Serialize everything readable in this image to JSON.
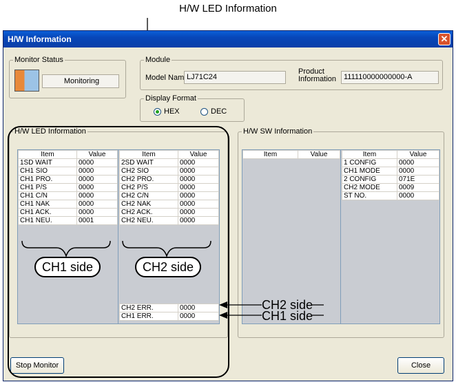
{
  "caption": "H/W LED Information",
  "window": {
    "title": "H/W Information",
    "close": "✕"
  },
  "monitor_status": {
    "label": "Monitor Status",
    "value": "Monitoring"
  },
  "module": {
    "label": "Module",
    "model_name_label": "Model Name",
    "model_name": "LJ71C24",
    "product_info_label": "Product Information",
    "product_info": "111110000000000-A"
  },
  "display_format": {
    "label": "Display Format",
    "hex": "HEX",
    "dec": "DEC",
    "selected": "HEX"
  },
  "led": {
    "label": "H/W LED Information",
    "headers": [
      "Item",
      "Value"
    ],
    "left": [
      [
        "1SD WAIT",
        "0000"
      ],
      [
        "CH1 SIO",
        "0000"
      ],
      [
        "CH1 PRO.",
        "0000"
      ],
      [
        "CH1 P/S",
        "0000"
      ],
      [
        "CH1 C/N",
        "0000"
      ],
      [
        "CH1 NAK",
        "0000"
      ],
      [
        "CH1 ACK.",
        "0000"
      ],
      [
        "CH1 NEU.",
        "0001"
      ]
    ],
    "right": [
      [
        "2SD WAIT",
        "0000"
      ],
      [
        "CH2 SIO",
        "0000"
      ],
      [
        "CH2 PRO.",
        "0000"
      ],
      [
        "CH2 P/S",
        "0000"
      ],
      [
        "CH2 C/N",
        "0000"
      ],
      [
        "CH2 NAK",
        "0000"
      ],
      [
        "CH2 ACK.",
        "0000"
      ],
      [
        "CH2 NEU.",
        "0000"
      ]
    ],
    "right_bottom": [
      [
        "CH2 ERR.",
        "0000"
      ],
      [
        "CH1 ERR.",
        "0000"
      ]
    ]
  },
  "sw": {
    "label": "H/W SW Information",
    "headers": [
      "Item",
      "Value"
    ],
    "right": [
      [
        "1 CONFIG",
        "0000"
      ],
      [
        "CH1 MODE",
        "0000"
      ],
      [
        "2 CONFIG",
        "071E"
      ],
      [
        "CH2 MODE",
        "0009"
      ],
      [
        "ST NO.",
        "0000"
      ]
    ]
  },
  "buttons": {
    "stop": "Stop Monitor",
    "close": "Close"
  },
  "callouts": {
    "ch1": "CH1 side",
    "ch2": "CH2 side",
    "ch2_side": "CH2 side",
    "ch1_side": "CH1 side"
  }
}
